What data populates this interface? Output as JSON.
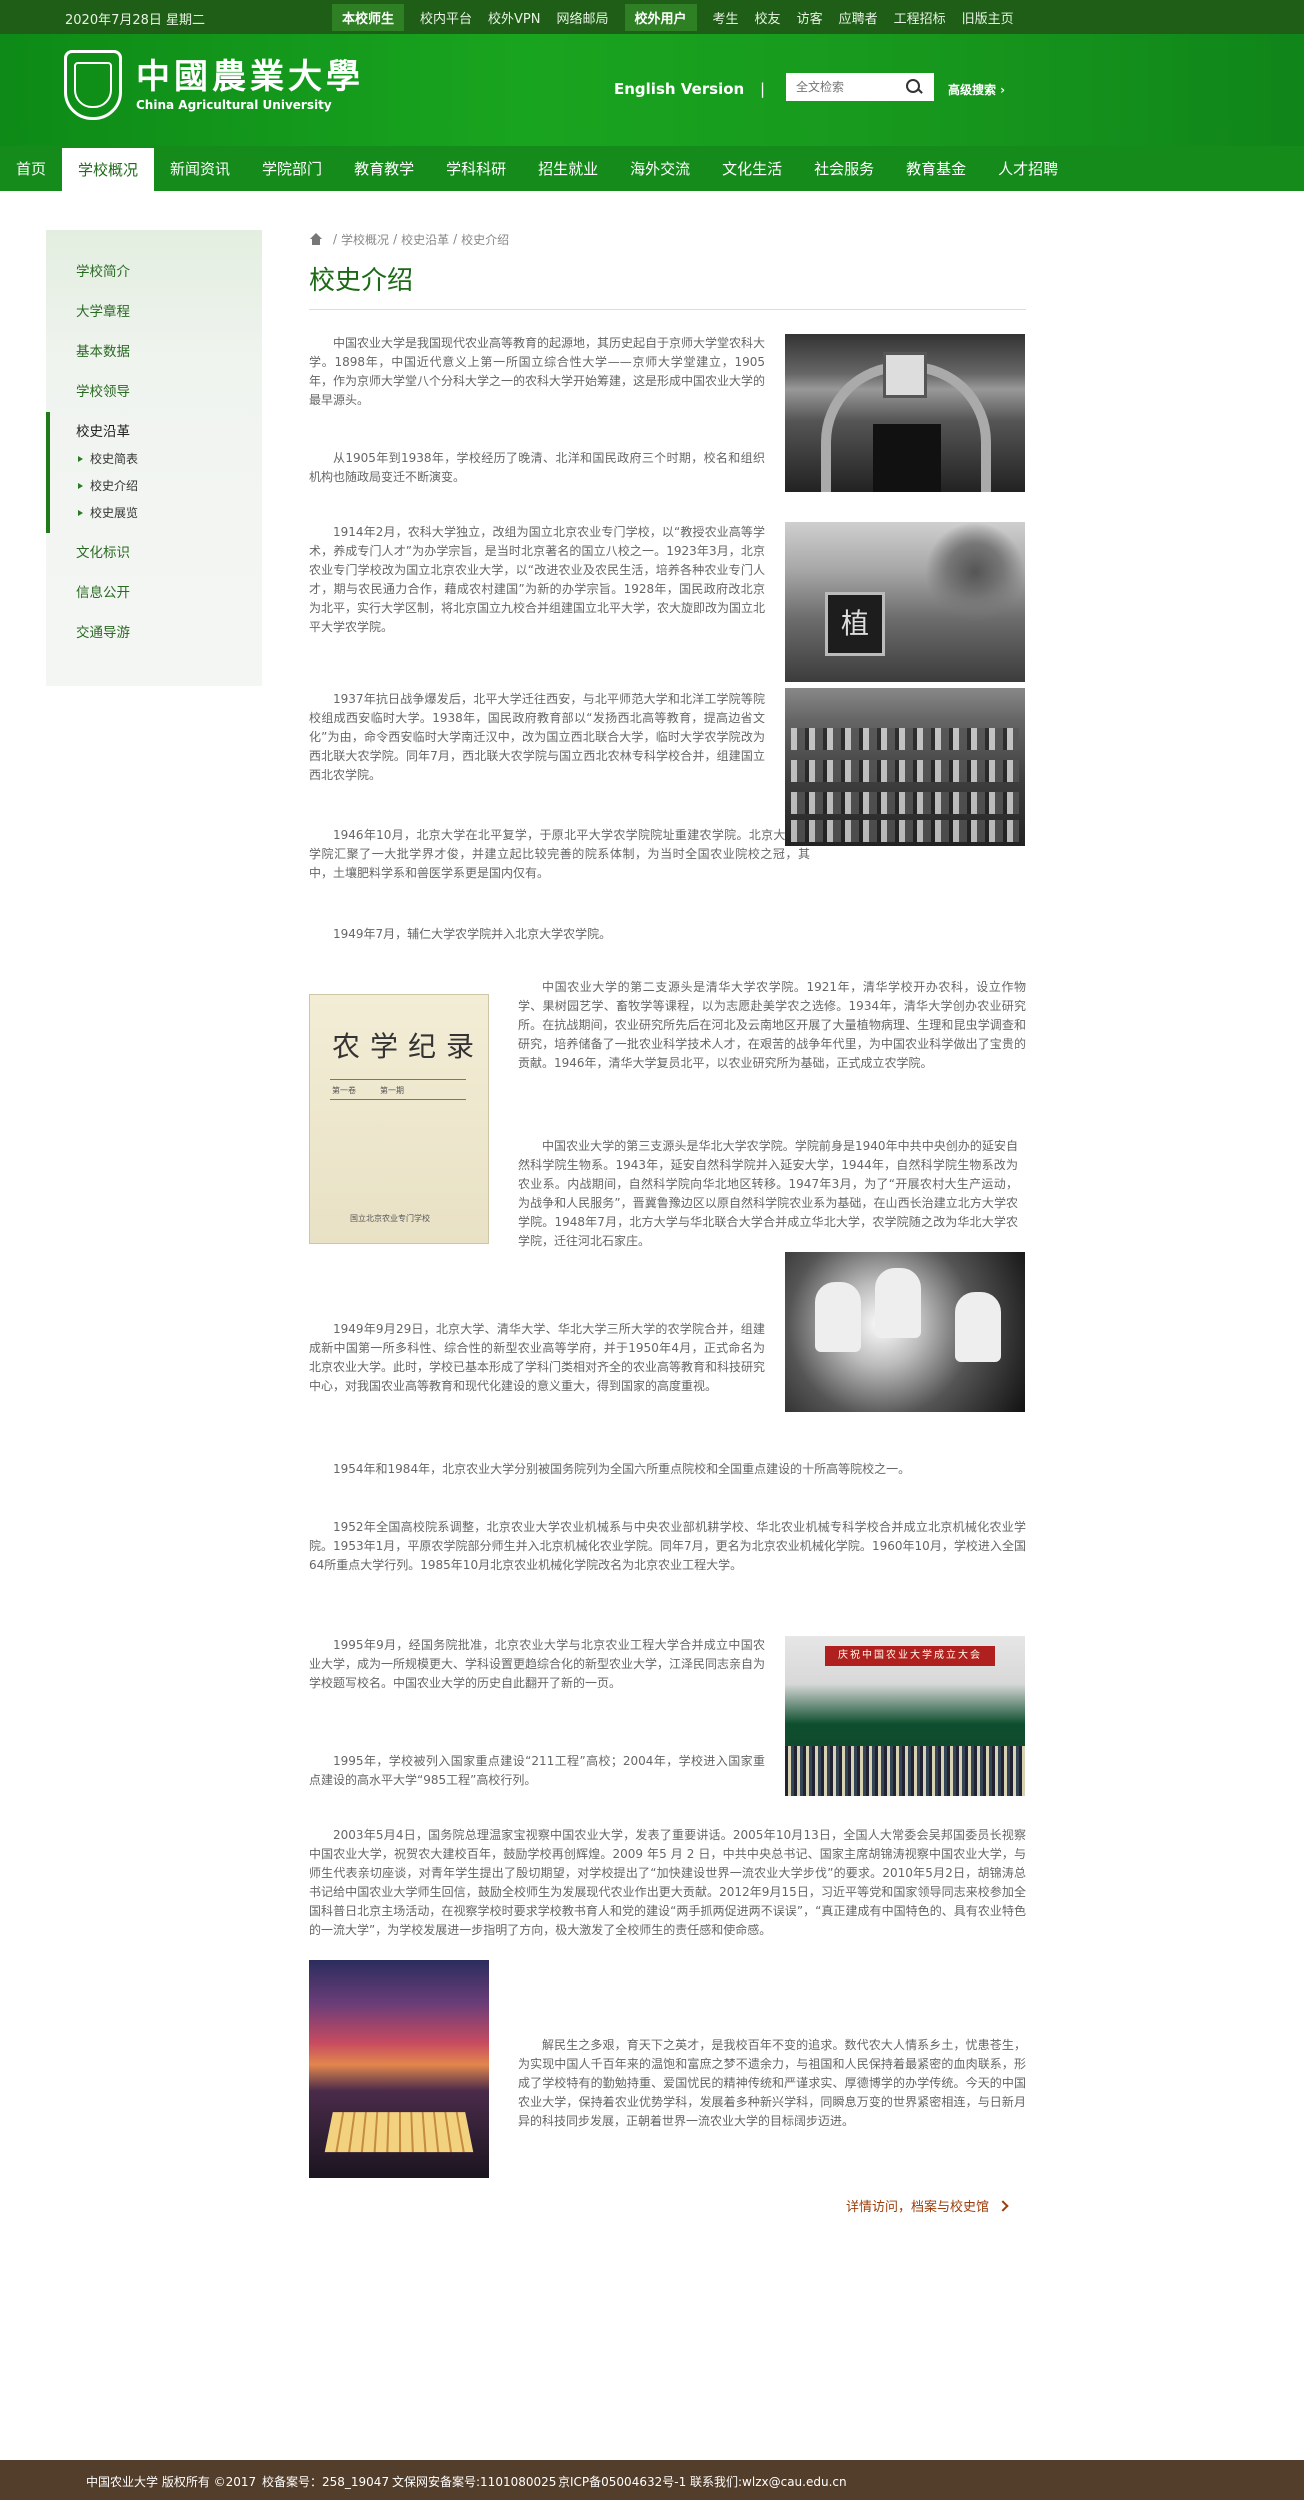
{
  "topbar": {
    "date": "2020年7月28日 星期二",
    "links": [
      {
        "label": "本校师生",
        "highlight": true
      },
      {
        "label": "校内平台",
        "highlight": false
      },
      {
        "label": "校外VPN",
        "highlight": false
      },
      {
        "label": "网络邮局",
        "highlight": false
      },
      {
        "label": "校外用户",
        "highlight": true
      },
      {
        "label": "考生",
        "highlight": false
      },
      {
        "label": "校友",
        "highlight": false
      },
      {
        "label": "访客",
        "highlight": false
      },
      {
        "label": "应聘者",
        "highlight": false
      },
      {
        "label": "工程招标",
        "highlight": false
      },
      {
        "label": "旧版主页",
        "highlight": false
      }
    ]
  },
  "header": {
    "logo_cn": "中國農業大學",
    "logo_en": "China Agricultural University",
    "english_version": "English Version",
    "separator": "|",
    "search_placeholder": "全文检索",
    "advanced_search": "高级搜索 ›"
  },
  "nav": [
    "首页",
    "学校概况",
    "新闻资讯",
    "学院部门",
    "教育教学",
    "学科科研",
    "招生就业",
    "海外交流",
    "文化生活",
    "社会服务",
    "教育基金",
    "人才招聘"
  ],
  "nav_active_index": 1,
  "sidebar": {
    "items_top": [
      "学校简介",
      "大学章程",
      "基本数据",
      "学校领导"
    ],
    "current": "校史沿革",
    "sub": [
      "校史简表",
      "校史介绍",
      "校史展览"
    ],
    "items_bottom": [
      "文化标识",
      "信息公开",
      "交通导游"
    ]
  },
  "breadcrumb": [
    "学校概况",
    "校史沿革",
    "校史介绍"
  ],
  "page_title": "校史介绍",
  "paragraphs": [
    "中国农业大学是我国现代农业高等教育的起源地，其历史起自于京师大学堂农科大学。1898年，中国近代意义上第一所国立综合性大学——京师大学堂建立，1905年，作为京师大学堂八个分科大学之一的农科大学开始筹建，这是形成中国农业大学的最早源头。",
    "从1905年到1938年，学校经历了晚清、北洋和国民政府三个时期，校名和组织机构也随政局变迁不断演变。",
    "1914年2月，农科大学独立，改组为国立北京农业专门学校，以“教授农业高等学术，养成专门人才”为办学宗旨，是当时北京著名的国立八校之一。1923年3月，北京农业专门学校改为国立北京农业大学，以“改进农业及农民生活，培养各种农业专门人才，期与农民通力合作，藉成农村建国”为新的办学宗旨。1928年，国民政府改北京为北平，实行大学区制，将北京国立九校合并组建国立北平大学，农大旋即改为国立北平大学农学院。",
    "1937年抗日战争爆发后，北平大学迁往西安，与北平师范大学和北洋工学院等院校组成西安临时大学。1938年，国民政府教育部以“发扬西北高等教育，提高边省文化”为由，命令西安临时大学南迁汉中，改为国立西北联合大学，临时大学农学院改为西北联大农学院。同年7月，西北联大农学院与国立西北农林专科学校合并，组建国立西北农学院。",
    "1946年10月，北京大学在北平复学，于原北平大学农学院院址重建农学院。北京大学农学院汇聚了一大批学界才俊，并建立起比较完善的院系体制，为当时全国农业院校之冠，其中，土壤肥料学系和兽医学系更是国内仅有。",
    "1949年7月，辅仁大学农学院并入北京大学农学院。",
    "中国农业大学的第二支源头是清华大学农学院。1921年，清华学校开办农科，设立作物学、果树园艺学、畜牧学等课程，以为志愿赴美学农之选修。1934年，清华大学创办农业研究所。在抗战期间，农业研究所先后在河北及云南地区开展了大量植物病理、生理和昆虫学调查和研究，培养储备了一批农业科学技术人才，在艰苦的战争年代里，为中国农业科学做出了宝贵的贡献。1946年，清华大学复员北平，以农业研究所为基础，正式成立农学院。",
    "中国农业大学的第三支源头是华北大学农学院。学院前身是1940年中共中央创办的延安自然科学院生物系。1943年，延安自然科学院并入延安大学，1944年，自然科学院生物系改为农业系。内战期间，自然科学院向华北地区转移。1947年3月，为了“开展农村大生产运动，为战争和人民服务”，晋冀鲁豫边区以原自然科学院农业系为基础，在山西长治建立北方大学农学院。1948年7月，北方大学与华北联合大学合并成立华北大学，农学院随之改为华北大学农学院，迁往河北石家庄。",
    "1949年9月29日，北京大学、清华大学、华北大学三所大学的农学院合并，组建成新中国第一所多科性、综合性的新型农业高等学府，并于1950年4月，正式命名为北京农业大学。此时，学校已基本形成了学科门类相对齐全的农业高等教育和科技研究中心，对我国农业高等教育和现代化建设的意义重大，得到国家的高度重视。",
    "1954年和1984年，北京农业大学分别被国务院列为全国六所重点院校和全国重点建设的十所高等院校之一。",
    "1952年全国高校院系调整，北京农业大学农业机械系与中央农业部机耕学校、华北农业机械专科学校合并成立北京机械化农业学院。1953年1月，平原农学院部分师生并入北京机械化农业学院。同年7月，更名为北京农业机械化学院。1960年10月，学校进入全国64所重点大学行列。1985年10月北京农业机械化学院改名为北京农业工程大学。",
    "1995年9月，经国务院批准，北京农业大学与北京农业工程大学合并成立中国农业大学，成为一所规模更大、学科设置更趋综合化的新型农业大学，江泽民同志亲自为学校题写校名。中国农业大学的历史自此翻开了新的一页。",
    "1995年，学校被列入国家重点建设“211工程”高校；2004年，学校进入国家重点建设的高水平大学“985工程”高校行列。",
    "2003年5月4日，国务院总理温家宝视察中国农业大学，发表了重要讲话。2005年10月13日，全国人大常委会吴邦国委员长视察中国农业大学，祝贺农大建校百年，鼓励学校再创辉煌。2009 年5 月 2 日，中共中央总书记、国家主席胡锦涛视察中国农业大学，与师生代表亲切座谈，对青年学生提出了殷切期望，对学校提出了“加快建设世界一流农业大学步伐”的要求。2010年5月2日，胡锦涛总书记给中国农业大学师生回信，鼓励全校师生为发展现代农业作出更大贡献。2012年9月15日，习近平等党和国家领导同志来校参加全国科普日北京主场活动，在视察学校时要求学校教书育人和党的建设“两手抓两促进两不误误”，“真正建成有中国特色的、具有农业特色的一流大学”，为学校发展进一步指明了方向，极大激发了全校师生的责任感和使命感。",
    "解民生之多艰，育天下之英才，是我校百年不变的追求。数代农大人情系乡土，忧患苍生，为实现中国人千百年来的温饱和富庶之梦不遗余力，与祖国和人民保持着最紧密的血肉联系，形成了学校特有的勤勉持重、爱国忧民的精神传统和严谨求实、厚德博学的办学传统。今天的中国农业大学，保持着农业优势学科，发展着多种新兴学科，同瞬息万变的世界紧密相连，与日新月异的科技同步发展，正朝着世界一流农业大学的目标阔步迈进。"
  ],
  "book_cover": {
    "title": "农学纪录",
    "line1": "第一卷　　　第一期",
    "publisher": "国立北京农业专门学校"
  },
  "banner_text": "庆祝中国农业大学成立大会",
  "more_link": "详情访问，档案与校史馆",
  "footer": {
    "copyright": "中国农业大学 版权所有 ©2017",
    "school_code": "校备案号：258_19047",
    "police": "文保网安备案号:1101080025",
    "icp": "京ICP备05004632号-1",
    "contact": "联系我们:wlzx@cau.edu.cn"
  },
  "colors": {
    "topbar": "#1f5e16",
    "header_green": "#17981d",
    "nav_green": "#148b1a",
    "title_green": "#1c6a16",
    "link_brown": "#9c3d0a",
    "footer": "#533e2b"
  }
}
